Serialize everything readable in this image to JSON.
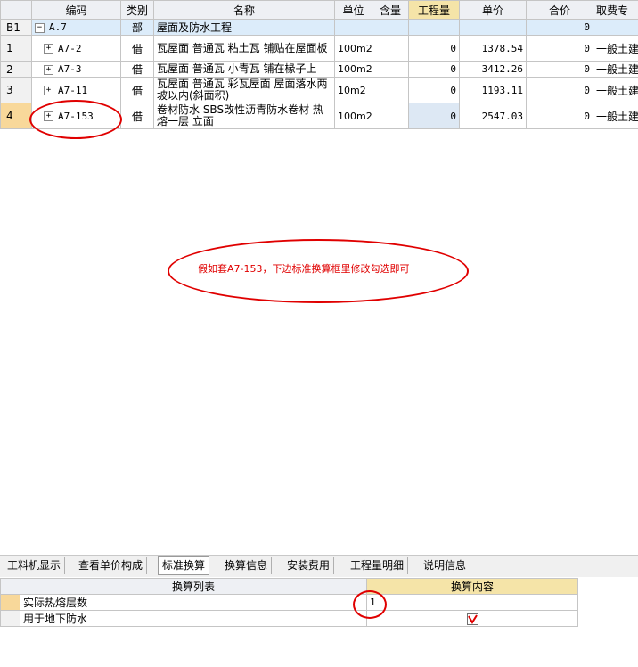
{
  "grid": {
    "headers": {
      "code": "编码",
      "type": "类别",
      "name": "名称",
      "unit": "单位",
      "content": "含量",
      "qty": "工程量",
      "price": "单价",
      "total": "合价",
      "fee": "取费专"
    },
    "section": {
      "row": "B1",
      "code": "A.7",
      "type": "部",
      "name": "屋面及防水工程",
      "total": "0",
      "toggle": "−"
    },
    "rows": [
      {
        "row": "1",
        "toggle": "+",
        "code": "A7-2",
        "type": "借",
        "name": "瓦屋面 普通瓦 粘土瓦 铺贴在屋面板",
        "unit": "100m2",
        "qty": "0",
        "price": "1378.54",
        "total": "0",
        "fee": "一般土建"
      },
      {
        "row": "2",
        "toggle": "+",
        "code": "A7-3",
        "type": "借",
        "name": "瓦屋面 普通瓦 小青瓦 铺在椽子上",
        "unit": "100m2",
        "qty": "0",
        "price": "3412.26",
        "total": "0",
        "fee": "一般土建"
      },
      {
        "row": "3",
        "toggle": "+",
        "code": "A7-11",
        "type": "借",
        "name": "瓦屋面 普通瓦 彩瓦屋面 屋面落水两坡以内(斜面积)",
        "unit": "10m2",
        "qty": "0",
        "price": "1193.11",
        "total": "0",
        "fee": "一般土建"
      },
      {
        "row": "4",
        "toggle": "+",
        "code": "A7-153",
        "type": "借",
        "name": "卷材防水 SBS改性沥青防水卷材 热熔一层 立面",
        "unit": "100m2",
        "qty": "0",
        "price": "2547.03",
        "total": "0",
        "fee": "一般土建"
      }
    ]
  },
  "annotation": {
    "text": "假如套A7-153，下边标准换算框里修改勾选即可",
    "color": "#e00000"
  },
  "tabs": [
    "工料机显示",
    "查看单价构成",
    "标准换算",
    "换算信息",
    "安装费用",
    "工程量明细",
    "说明信息"
  ],
  "active_tab": "标准换算",
  "conversion": {
    "headers": {
      "list": "换算列表",
      "content": "换算内容"
    },
    "rows": [
      {
        "label": "实际热熔层数",
        "value": "1"
      },
      {
        "label": "用于地下防水",
        "checked": true
      }
    ]
  },
  "colors": {
    "header": "#eef0f4",
    "highlight_header": "#f5e4a8",
    "section_row": "#dcecfa",
    "selected_row": "#f8d89a"
  }
}
